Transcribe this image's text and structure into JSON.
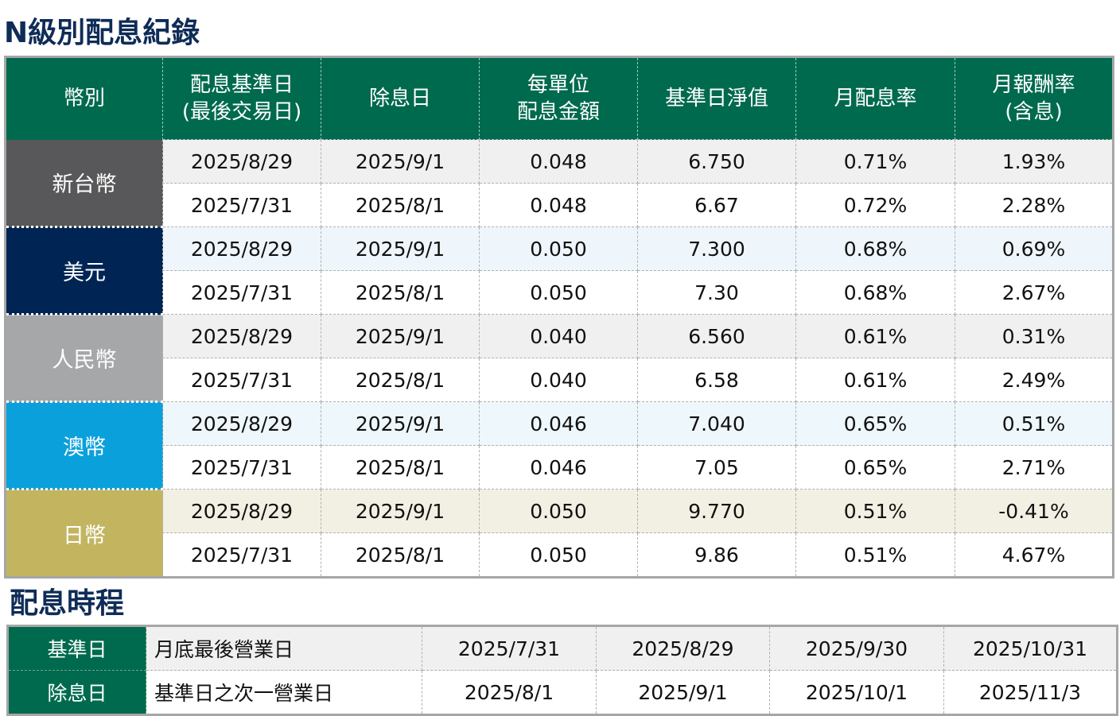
{
  "title": "N級別配息紀錄",
  "headers": [
    "幣別",
    "配息基準日\n(最後交易日)",
    "除息日",
    "每單位\n配息金額",
    "基準日淨值",
    "月配息率",
    "月報酬率\n(含息)"
  ],
  "groups": [
    {
      "currency": "新台幣",
      "color": "#58585a",
      "tint": "#f0f0f0",
      "rows": [
        [
          "2025/8/29",
          "2025/9/1",
          "0.048",
          "6.750",
          "0.71%",
          "1.93%"
        ],
        [
          "2025/7/31",
          "2025/8/1",
          "0.048",
          "6.67",
          "0.72%",
          "2.28%"
        ]
      ]
    },
    {
      "currency": "美元",
      "color": "#002554",
      "tint": "#eef6fc",
      "rows": [
        [
          "2025/8/29",
          "2025/9/1",
          "0.050",
          "7.300",
          "0.68%",
          "0.69%"
        ],
        [
          "2025/7/31",
          "2025/8/1",
          "0.050",
          "7.30",
          "0.68%",
          "2.67%"
        ]
      ]
    },
    {
      "currency": "人民幣",
      "color": "#a6a7a9",
      "tint": "#f0f0f0",
      "rows": [
        [
          "2025/8/29",
          "2025/9/1",
          "0.040",
          "6.560",
          "0.61%",
          "0.31%"
        ],
        [
          "2025/7/31",
          "2025/8/1",
          "0.040",
          "6.58",
          "0.61%",
          "2.49%"
        ]
      ]
    },
    {
      "currency": "澳幣",
      "color": "#0aa0dc",
      "tint": "#eef7fb",
      "rows": [
        [
          "2025/8/29",
          "2025/9/1",
          "0.046",
          "7.040",
          "0.65%",
          "0.51%"
        ],
        [
          "2025/7/31",
          "2025/8/1",
          "0.046",
          "7.05",
          "0.65%",
          "2.71%"
        ]
      ]
    },
    {
      "currency": "日幣",
      "color": "#c3b560",
      "tint": "#f1f0e2",
      "rows": [
        [
          "2025/8/29",
          "2025/9/1",
          "0.050",
          "9.770",
          "0.51%",
          "-0.41%"
        ],
        [
          "2025/7/31",
          "2025/8/1",
          "0.050",
          "9.86",
          "0.51%",
          "4.67%"
        ]
      ]
    }
  ],
  "schedule_title": "配息時程",
  "schedule": [
    {
      "label": "基準日",
      "desc": "月底最後營業日",
      "dates": [
        "2025/7/31",
        "2025/8/29",
        "2025/9/30",
        "2025/10/31"
      ],
      "tint": "#f0f0f0"
    },
    {
      "label": "除息日",
      "desc": "基準日之次一營業日",
      "dates": [
        "2025/8/1",
        "2025/9/1",
        "2025/10/1",
        "2025/11/3"
      ],
      "tint": "#ffffff"
    }
  ]
}
